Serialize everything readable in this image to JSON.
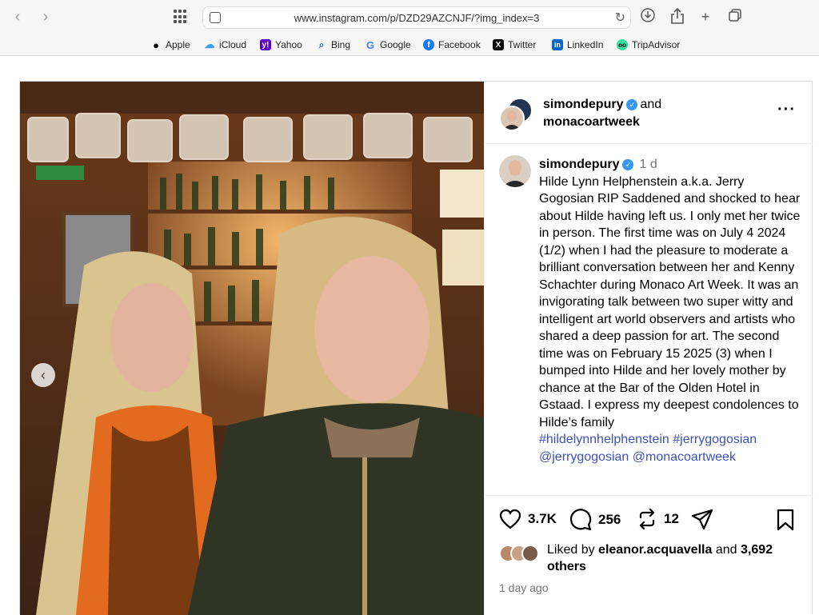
{
  "browser": {
    "url": "www.instagram.com/p/DZD29AZCNJF/?img_index=3",
    "bookmarks": [
      {
        "label": "Apple",
        "color": "#000000",
        "glyph": ""
      },
      {
        "label": "iCloud",
        "color": "#3b9df0",
        "glyph": "☁"
      },
      {
        "label": "Yahoo",
        "color": "#6001d2",
        "glyph": "y!"
      },
      {
        "label": "Bing",
        "color": "#2b6fd6",
        "glyph": "⌕"
      },
      {
        "label": "Google",
        "color": "#4285f4",
        "glyph": "G"
      },
      {
        "label": "Facebook",
        "color": "#1877f2",
        "glyph": "f"
      },
      {
        "label": "Twitter",
        "color": "#000000",
        "glyph": "X"
      },
      {
        "label": "LinkedIn",
        "color": "#0a66c2",
        "glyph": "in"
      },
      {
        "label": "TripAdvisor",
        "color": "#34e0a1",
        "glyph": "●"
      }
    ]
  },
  "post": {
    "header": {
      "user1": "simondepury",
      "joiner": "and",
      "user2": "monacoartweek"
    },
    "caption": {
      "username": "simondepury",
      "time": "1 d",
      "text": "Hilde Lynn Helphenstein a.k.a. Jerry Gogosian RIP Saddened and shocked to hear about Hilde having left us. I only met her twice in person. The first time was on July 4 2024 (1/2) when I had the pleasure to moderate a brilliant conversation between her and Kenny Schachter during Monaco Art Week. It was an invigorating talk between two super witty and intelligent art world observers and artists who shared a deep passion for art. The second time was on February 15 2025 (3) when I bumped into Hilde and her lovely mother by chance at the Bar of the Olden Hotel in Gstaad. I express my deepest condolences to Hilde’s family",
      "hashtag1": "#hildelynnhelphenstein",
      "hashtag2": "#jerrygogosian",
      "mention1": "@jerrygogosian",
      "mention2": "@monacoartweek"
    },
    "actions": {
      "likes": "3.7K",
      "comments": "256",
      "reposts": "12"
    },
    "liked_by": {
      "prefix": "Liked by",
      "user": "eleanor.acquavella",
      "joiner": "and",
      "count": "3,692",
      "suffix": "others"
    },
    "ago": "1 day ago"
  }
}
